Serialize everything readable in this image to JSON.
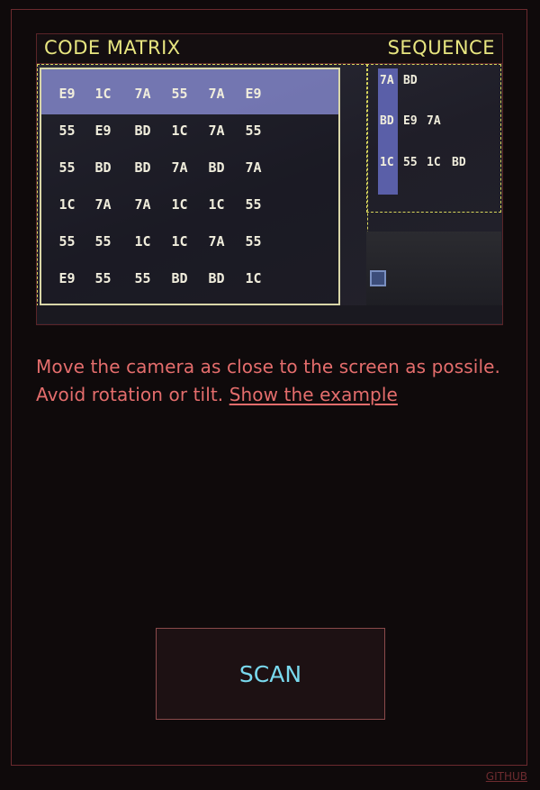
{
  "viewfinder": {
    "matrix_label": "CODE MATRIX",
    "sequence_label": "SEQUENCE",
    "matrix": [
      [
        "E9",
        "1C",
        "7A",
        "55",
        "7A",
        "E9"
      ],
      [
        "55",
        "E9",
        "BD",
        "1C",
        "7A",
        "55"
      ],
      [
        "55",
        "BD",
        "BD",
        "7A",
        "BD",
        "7A"
      ],
      [
        "1C",
        "7A",
        "7A",
        "1C",
        "1C",
        "55"
      ],
      [
        "55",
        "55",
        "1C",
        "1C",
        "7A",
        "55"
      ],
      [
        "E9",
        "55",
        "55",
        "BD",
        "BD",
        "1C"
      ]
    ],
    "sequences": [
      [
        "7A",
        "BD"
      ],
      [
        "BD",
        "E9",
        "7A"
      ],
      [
        "1C",
        "55",
        "1C",
        "BD"
      ]
    ],
    "colors": {
      "label": "#e8e680",
      "highlight_row": "#7c7fc0",
      "dashed": "#d8d65c"
    }
  },
  "instructions": {
    "text": "Move the camera as close to the screen as possile. Avoid rotation or tilt. ",
    "link_label": "Show the example"
  },
  "scan_button": {
    "label": "SCAN",
    "color": "#79d9ee"
  },
  "footer": {
    "github_label": "GITHUB"
  },
  "colors": {
    "background": "#0f0a0b",
    "accent": "#e46d6c",
    "border": "#6b2a2e"
  }
}
